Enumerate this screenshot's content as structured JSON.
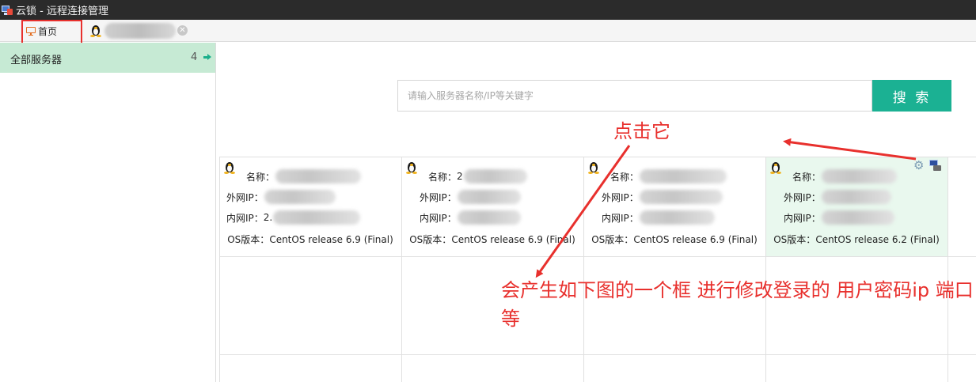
{
  "window": {
    "title": "云锁 - 远程连接管理"
  },
  "tabs": [
    {
      "label": "首页",
      "icon": "monitor-icon",
      "active": true
    },
    {
      "label": "",
      "icon": "penguin-icon",
      "closable": true
    }
  ],
  "sidebar": {
    "items": [
      {
        "label": "全部服务器",
        "count": "4"
      }
    ]
  },
  "search": {
    "placeholder": "请输入服务器名称/IP等关键字",
    "button_label": "搜 索"
  },
  "servers": [
    {
      "name_label": "名称",
      "name_value": "",
      "wan_label": "外网IP",
      "wan_value": "",
      "lan_label": "内网IP",
      "lan_value": "2.",
      "os_label": "OS版本",
      "os_value": "CentOS release 6.9 (Final)"
    },
    {
      "name_label": "名称",
      "name_value": "2",
      "wan_label": "外网IP",
      "wan_value": "",
      "lan_label": "内网IP",
      "lan_value": "",
      "os_label": "OS版本",
      "os_value": "CentOS release 6.9 (Final)"
    },
    {
      "name_label": "名称",
      "name_value": "",
      "wan_label": "外网IP",
      "wan_value": "",
      "lan_label": "内网IP",
      "lan_value": "",
      "os_label": "OS版本",
      "os_value": "CentOS release 6.9 (Final)"
    },
    {
      "name_label": "名称",
      "name_value": "",
      "wan_label": "外网IP",
      "wan_value": "",
      "lan_label": "内网IP",
      "lan_value": "",
      "os_label": "OS版本",
      "os_value": "CentOS release 6.2 (Final)"
    }
  ],
  "annotations": {
    "click_it": "点击它",
    "description": "会产生如下图的一个框 进行修改登录的 用户密码ip 端口等"
  },
  "colors": {
    "accent": "#1bb193",
    "sidebar_selected": "#c6ead4",
    "card_highlight": "#e9f8ee",
    "annotation": "#e8302d"
  }
}
